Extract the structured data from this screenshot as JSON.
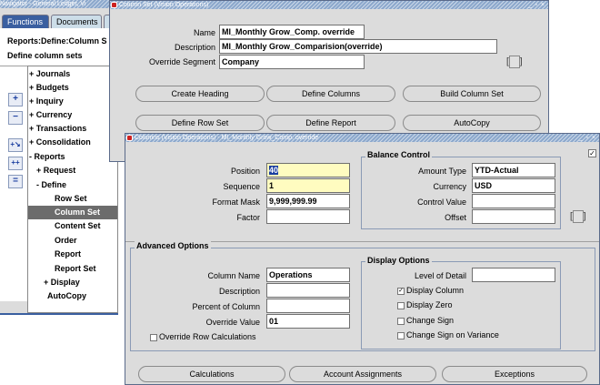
{
  "navigator": {
    "title": "Navigator - General Ledger, Vi",
    "tabs": [
      "Functions",
      "Documents"
    ],
    "heading": "Reports:Define:Column S",
    "subheading": "Define column sets",
    "tree": [
      {
        "label": "+ Journals"
      },
      {
        "label": "+ Budgets"
      },
      {
        "label": "+ Inquiry"
      },
      {
        "label": "+ Currency"
      },
      {
        "label": "+ Transactions"
      },
      {
        "label": "+ Consolidation"
      },
      {
        "label": "- Reports"
      },
      {
        "label": "+ Request"
      },
      {
        "label": "- Define"
      },
      {
        "label": "Row Set"
      },
      {
        "label": "Column Set"
      },
      {
        "label": "Content Set"
      },
      {
        "label": "Order"
      },
      {
        "label": "Report"
      },
      {
        "label": "Report Set"
      },
      {
        "label": "+ Display"
      },
      {
        "label": "AutoCopy"
      }
    ]
  },
  "column_set": {
    "title": "Column Set (Vision Operations)",
    "name_label": "Name",
    "name_value": "MI_Monthly Grow_Comp. override",
    "description_label": "Description",
    "description_value": "MI_Monthly Grow_Comparision(override)",
    "override_segment_label": "Override Segment",
    "override_segment_value": "Company",
    "buttons": [
      "Create Heading",
      "Define Columns",
      "Build Column Set",
      "Define Row Set",
      "Define Report",
      "AutoCopy"
    ]
  },
  "columns": {
    "title": "Columns (Vision Operations) - MI_Monthly Grow_Comp. override",
    "position_label": "Position",
    "position_value": "40",
    "sequence_label": "Sequence",
    "sequence_value": "1",
    "format_mask_label": "Format Mask",
    "format_mask_value": "9,999,999.99",
    "factor_label": "Factor",
    "factor_value": "",
    "balance_control": {
      "title": "Balance Control",
      "amount_type_label": "Amount Type",
      "amount_type_value": "YTD-Actual",
      "currency_label": "Currency",
      "currency_value": "USD",
      "control_value_label": "Control Value",
      "control_value_value": "",
      "offset_label": "Offset",
      "offset_value": ""
    },
    "advanced_options": {
      "title": "Advanced Options",
      "column_name_label": "Column Name",
      "column_name_value": "Operations",
      "description_label": "Description",
      "description_value": "",
      "percent_label": "Percent of Column",
      "percent_value": "",
      "override_value_label": "Override Value",
      "override_value_value": "01",
      "override_row_calc_label": "Override Row Calculations",
      "override_row_calc_checked": false
    },
    "display_options": {
      "title": "Display Options",
      "level_of_detail_label": "Level of Detail",
      "level_of_detail_value": "",
      "display_column_label": "Display Column",
      "display_column_checked": true,
      "display_zero_label": "Display Zero",
      "display_zero_checked": false,
      "change_sign_label": "Change Sign",
      "change_sign_checked": false,
      "change_sign_variance_label": "Change Sign on Variance",
      "change_sign_variance_checked": false
    },
    "buttons": [
      "Calculations",
      "Account Assignments",
      "Exceptions"
    ]
  },
  "colors": {
    "title_bar": "#8ca8cc",
    "window_bg": "#dcdcdc",
    "highlight": "#1a3ea0",
    "required_field": "#fffcc0",
    "selected_item": "#6c6c6c"
  }
}
